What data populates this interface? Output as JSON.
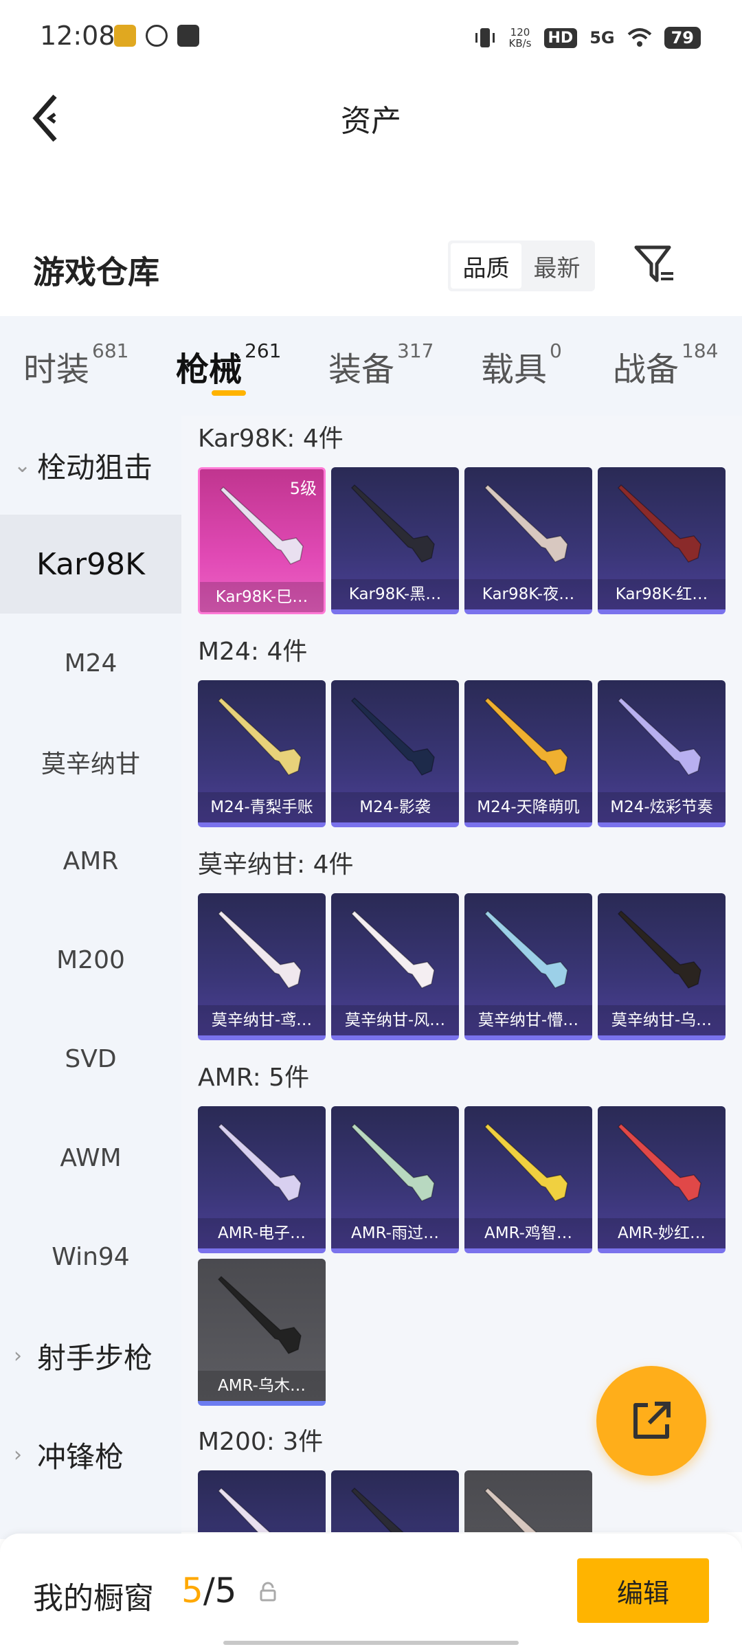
{
  "status_bar": {
    "time": "12:08",
    "net_speed_value": "120",
    "net_speed_unit": "KB/s",
    "hd": "HD",
    "signal": "5G",
    "battery": "79"
  },
  "header": {
    "title": "资产"
  },
  "section": {
    "title": "游戏仓库",
    "sort_options": [
      "品质",
      "最新"
    ]
  },
  "tabs": [
    {
      "label": "时装",
      "count": "681"
    },
    {
      "label": "枪械",
      "count": "261"
    },
    {
      "label": "装备",
      "count": "317"
    },
    {
      "label": "载具",
      "count": "0"
    },
    {
      "label": "战备",
      "count": "184"
    }
  ],
  "sidebar": {
    "items": [
      {
        "label": "栓动狙击",
        "type": "group",
        "chevron": "⌄"
      },
      {
        "label": "Kar98K",
        "type": "item"
      },
      {
        "label": "M24",
        "type": "item"
      },
      {
        "label": "莫辛纳甘",
        "type": "item"
      },
      {
        "label": "AMR",
        "type": "item"
      },
      {
        "label": "M200",
        "type": "item"
      },
      {
        "label": "SVD",
        "type": "item"
      },
      {
        "label": "AWM",
        "type": "item"
      },
      {
        "label": "Win94",
        "type": "item"
      },
      {
        "label": "射手步枪",
        "type": "group",
        "chevron": "›"
      },
      {
        "label": "冲锋枪",
        "type": "group",
        "chevron": "›"
      }
    ]
  },
  "groups": [
    {
      "label": "Kar98K: 4件",
      "cards": [
        {
          "name": "Kar98K-巳…",
          "level": "5级",
          "style": "gold"
        },
        {
          "name": "Kar98K-黑…",
          "style": "purple"
        },
        {
          "name": "Kar98K-夜…",
          "style": "purple"
        },
        {
          "name": "Kar98K-红…",
          "style": "purple"
        }
      ]
    },
    {
      "label": "M24: 4件",
      "cards": [
        {
          "name": "M24-青梨手账",
          "style": "purple"
        },
        {
          "name": "M24-影袭",
          "style": "purple"
        },
        {
          "name": "M24-天降萌叽",
          "style": "purple"
        },
        {
          "name": "M24-炫彩节奏",
          "style": "purple"
        }
      ]
    },
    {
      "label": "莫辛纳甘: 4件",
      "cards": [
        {
          "name": "莫辛纳甘-鸢…",
          "style": "purple"
        },
        {
          "name": "莫辛纳甘-风…",
          "style": "purple"
        },
        {
          "name": "莫辛纳甘-懵…",
          "style": "purple"
        },
        {
          "name": "莫辛纳甘-乌…",
          "style": "purple"
        }
      ]
    },
    {
      "label": "AMR: 5件",
      "cards": [
        {
          "name": "AMR-电子…",
          "style": "purple"
        },
        {
          "name": "AMR-雨过…",
          "style": "purple"
        },
        {
          "name": "AMR-鸡智…",
          "style": "purple"
        },
        {
          "name": "AMR-妙红…",
          "style": "purple"
        },
        {
          "name": "AMR-乌木…",
          "style": "grey"
        }
      ]
    },
    {
      "label": "M200: 3件",
      "cards": [
        {
          "name": "",
          "style": "purple"
        },
        {
          "name": "",
          "style": "purple"
        },
        {
          "name": "",
          "style": "grey"
        }
      ]
    }
  ],
  "bottom": {
    "showcase_label": "我的橱窗",
    "showcase_current": "5",
    "showcase_total": "/5",
    "edit_label": "编辑"
  },
  "colors": {
    "accent": "#ffb400",
    "tab_underline": "#ffb300",
    "card_purple": "#3a3677",
    "card_gold": "#e049b4"
  },
  "icons": {
    "back": "chevron-left-icon",
    "filter": "filter-icon",
    "share": "share-external-icon",
    "lock": "lock-icon"
  }
}
